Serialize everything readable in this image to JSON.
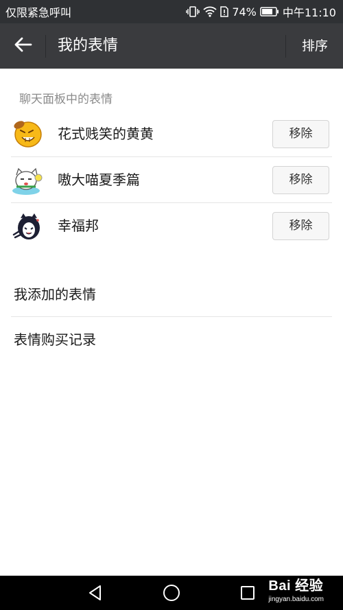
{
  "status_bar": {
    "carrier": "仅限紧急呼叫",
    "battery": "74%",
    "time": "中午11:10"
  },
  "header": {
    "title": "我的表情",
    "sort_label": "排序"
  },
  "section": {
    "title": "聊天面板中的表情"
  },
  "stickers": [
    {
      "name": "花式贱笑的黄黄",
      "icon": "yellow-face-sticker-icon",
      "remove_label": "移除"
    },
    {
      "name": "嗷大喵夏季篇",
      "icon": "cat-sticker-icon",
      "remove_label": "移除"
    },
    {
      "name": "幸福邦",
      "icon": "penguin-sticker-icon",
      "remove_label": "移除"
    }
  ],
  "menu": {
    "added": "我添加的表情",
    "purchases": "表情购买记录"
  },
  "watermark": {
    "brand": "Bai 经验",
    "url": "jingyan.baidu.com"
  },
  "colors": {
    "status_bar": "#2f3134",
    "header": "#3a3b3e",
    "nav_bar": "#000000"
  }
}
